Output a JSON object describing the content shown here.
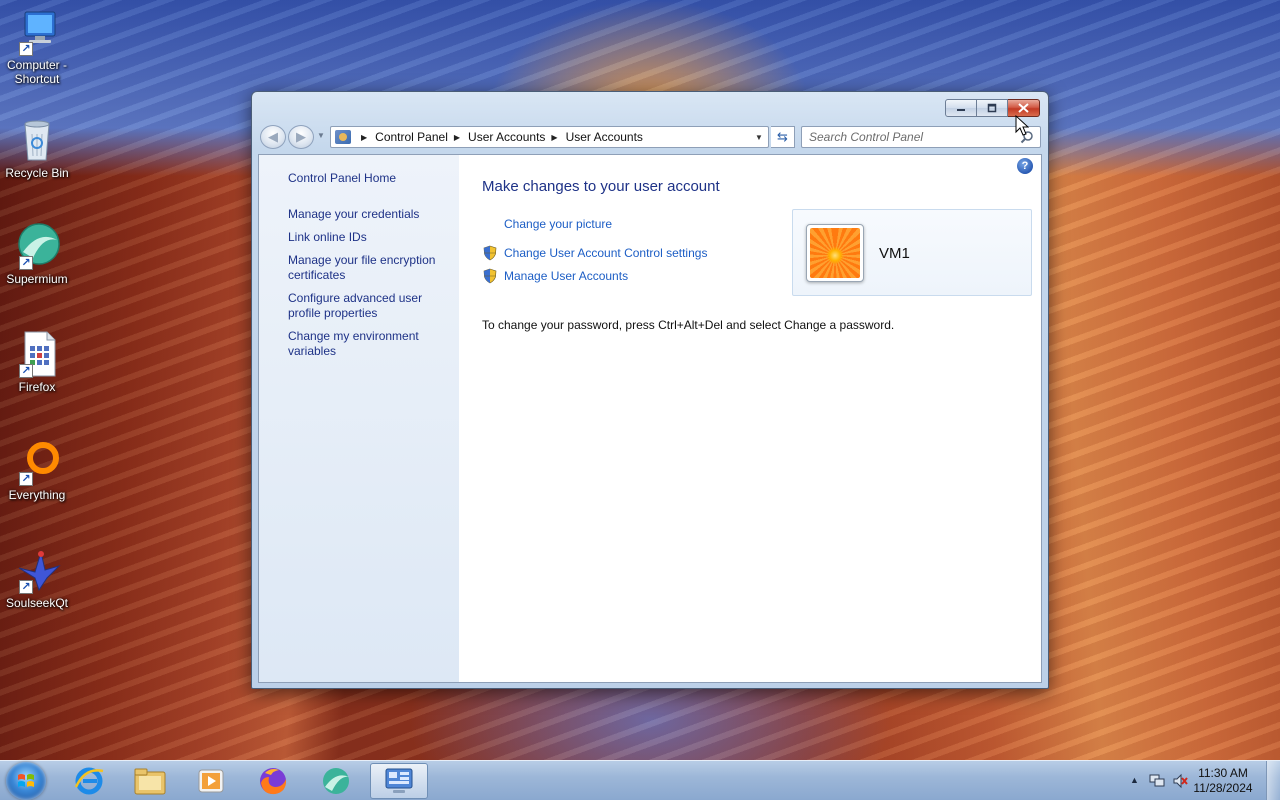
{
  "desktop": {
    "icons": [
      {
        "label": "Computer - Shortcut",
        "icon": "computer-icon"
      },
      {
        "label": "Recycle Bin",
        "icon": "recycle-bin-icon"
      },
      {
        "label": "Supermium",
        "icon": "supermium-icon"
      },
      {
        "label": "Firefox",
        "icon": "firefox-doc-icon"
      },
      {
        "label": "Everything",
        "icon": "everything-icon"
      },
      {
        "label": "SoulseekQt",
        "icon": "soulseek-icon"
      }
    ]
  },
  "window": {
    "address": {
      "crumbs": [
        "Control Panel",
        "User Accounts",
        "User Accounts"
      ]
    },
    "search": {
      "placeholder": "Search Control Panel"
    },
    "left_nav": {
      "home": "Control Panel Home",
      "links": [
        "Manage your credentials",
        "Link online IDs",
        "Manage your file encryption certificates",
        "Configure advanced user profile properties",
        "Change my environment variables"
      ]
    },
    "main": {
      "title": "Make changes to your user account",
      "tasks": [
        {
          "label": "Change your picture",
          "shield": false
        },
        {
          "label": "Change User Account Control settings",
          "shield": true
        },
        {
          "label": "Manage User Accounts",
          "shield": true
        }
      ],
      "user": {
        "name": "VM1"
      },
      "password_note": "To change your password, press Ctrl+Alt+Del and select Change a password."
    }
  },
  "taskbar": {
    "pinned": [
      "internet-explorer-icon",
      "file-explorer-icon",
      "media-player-icon",
      "firefox-icon",
      "supermium-icon",
      "control-panel-icon"
    ],
    "clock": {
      "time": "11:30 AM",
      "date": "11/28/2024"
    }
  },
  "colors": {
    "link": "#1d5ec5",
    "nav_link": "#1e3287",
    "title": "#1e3287",
    "taskbar": "#9db7d8"
  }
}
